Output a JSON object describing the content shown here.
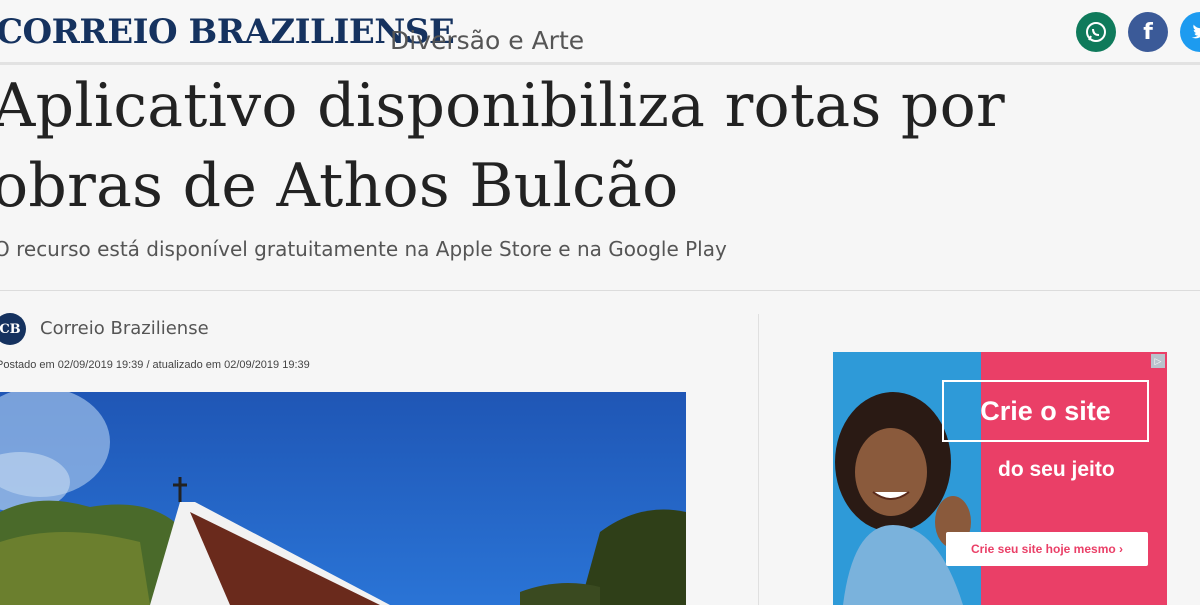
{
  "header": {
    "logo": "CORREIO BRAZILIENSE",
    "section": "Diversão e Arte",
    "share_icons": [
      "whatsapp-icon",
      "facebook-icon",
      "twitter-icon"
    ],
    "facebook_glyph": "f"
  },
  "article": {
    "title": "Aplicativo disponibiliza rotas por obras de Athos Bulcão",
    "subtitle": "O recurso está disponível gratuitamente na Apple Store e na Google Play",
    "author": {
      "initials": "CB",
      "name": "Correio Braziliense"
    },
    "dates": "Postado em 02/09/2019 19:39 / atualizado em 02/09/2019 19:39"
  },
  "ad": {
    "headline": "Crie o site",
    "subline": "do seu jeito",
    "cta": "Crie seu site hoje mesmo  ›",
    "choices_icon": "adchoices-icon"
  },
  "colors": {
    "brand": "#15325f",
    "whatsapp": "#0f7a5b",
    "facebook": "#3b5a98",
    "twitter": "#1d9bf0",
    "ad_pink": "#ea3f67",
    "ad_blue": "#2e9ad8"
  }
}
